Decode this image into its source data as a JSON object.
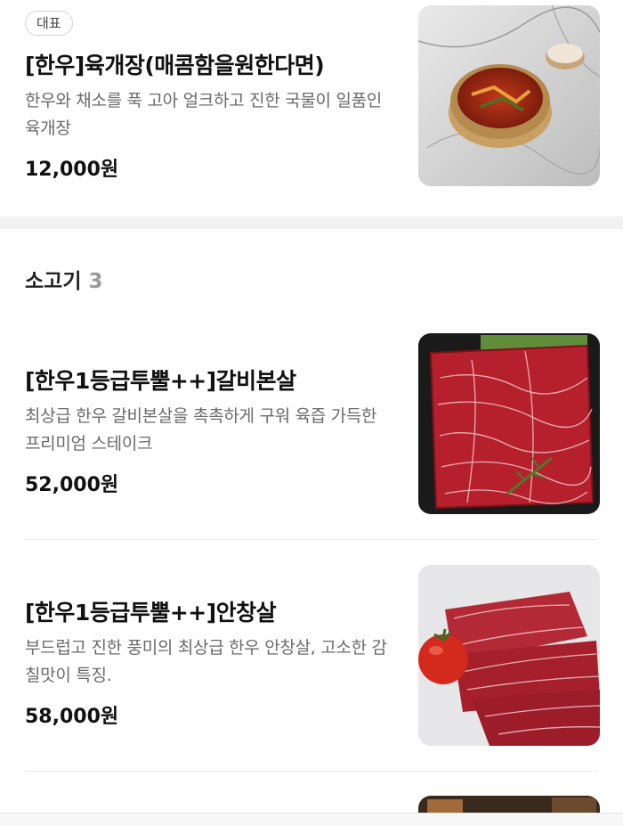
{
  "featured": {
    "badge": "대표",
    "name": "[한우]육개장(매콤함을원한다면)",
    "desc": "한우와 채소를 푹 고아 얼크하고 진한 국물이 일품인 육개장",
    "price": "12,000원",
    "image_icon": "yukgaejang-photo"
  },
  "category": {
    "title": "소고기",
    "count": "3",
    "items": [
      {
        "name": "[한우1등급투뿔++]갈비본살",
        "desc": "최상급 한우 갈비본살을 촉촉하게 구워 육즙 가득한 프리미엄 스테이크",
        "price": "52,000원",
        "image_icon": "galbi-beef-photo"
      },
      {
        "name": "[한우1등급투뿔++]안창살",
        "desc": "부드럽고 진한 풍미의 최상급 한우 안창살, 고소한 감칠맛이 특징.",
        "price": "58,000원",
        "image_icon": "anchang-beef-photo"
      }
    ]
  }
}
